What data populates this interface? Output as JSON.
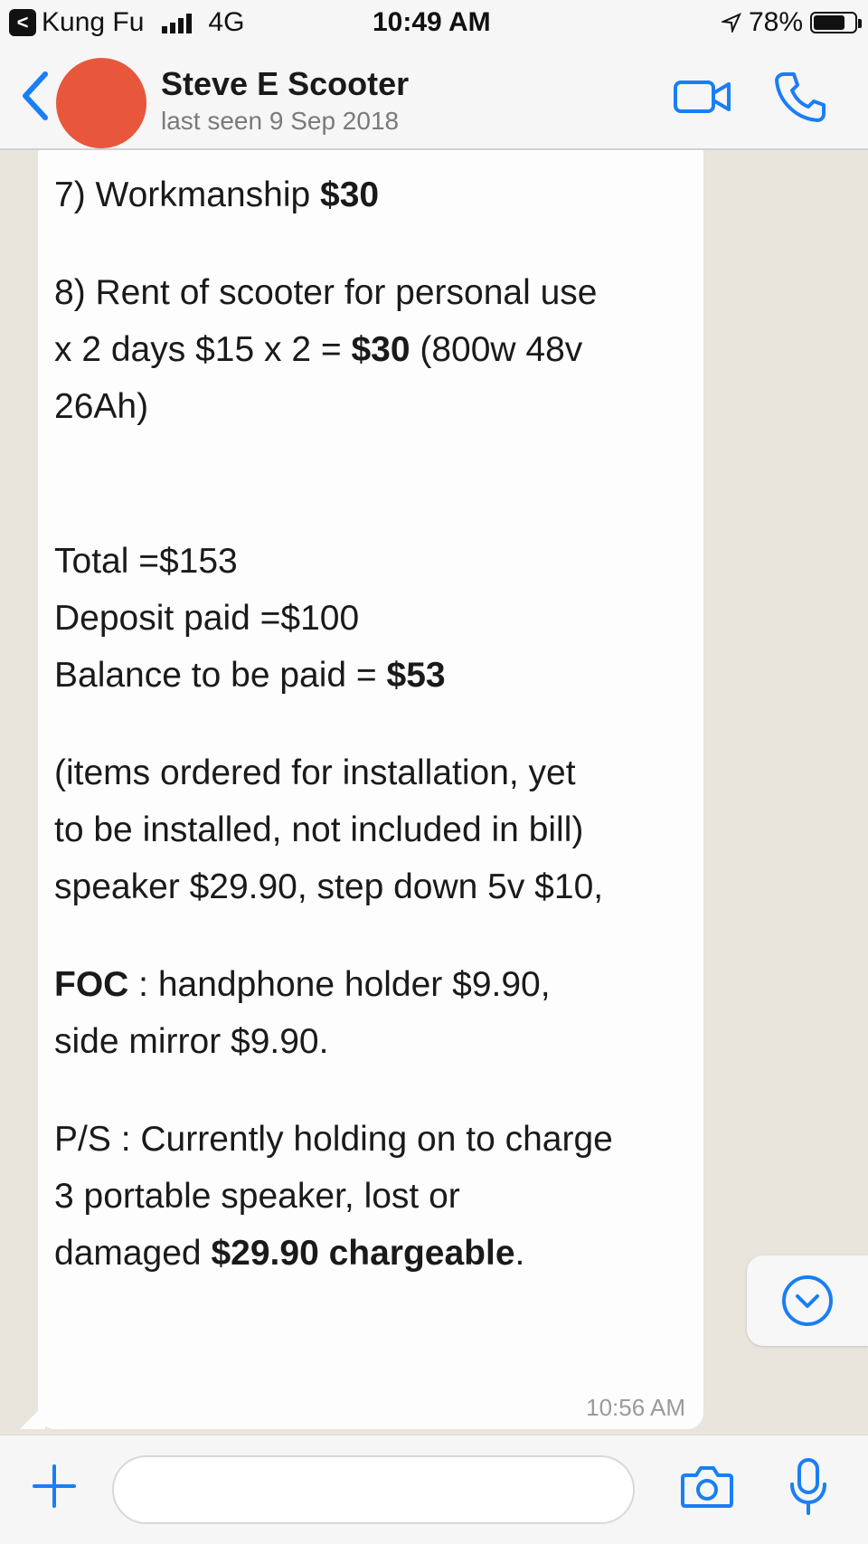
{
  "status_bar": {
    "back_app": "Kung Fu",
    "back_glyph": "<",
    "network": "4G",
    "time": "10:49 AM",
    "battery": "78%",
    "battery_level": 0.78
  },
  "header": {
    "contact_name": "Steve E Scooter",
    "last_seen": "last seen 9 Sep 2018"
  },
  "message": {
    "item7_prefix": "7) Workmanship ",
    "item7_amount": "$30",
    "item8_line1": "8)  Rent of scooter for personal use",
    "item8_line2_prefix": "x 2 days $15 x 2 = ",
    "item8_amount": "$30",
    "item8_line2_suffix": " (800w 48v",
    "item8_line3": "26Ah)",
    "total": "Total =$153",
    "deposit": "Deposit paid =$100",
    "balance_prefix": "Balance to be paid = ",
    "balance_amount": "$53",
    "items_line1": "(items ordered for installation, yet",
    "items_line2": "to be installed, not included in bill)",
    "items_line3": "speaker $29.90, step down 5v $10,",
    "foc_label": "FOC",
    "foc_line1_rest": " : handphone holder $9.90,",
    "foc_line2": "side mirror $9.90.",
    "ps_line1": "P/S : Currently holding on to charge",
    "ps_line2": "3 portable speaker, lost or",
    "ps_line3_prefix": "damaged ",
    "ps_line3_bold": "$29.90 chargeable",
    "ps_line3_end": ".",
    "timestamp": "10:56 AM"
  },
  "input": {
    "placeholder": ""
  },
  "colors": {
    "accent": "#1a7ef5",
    "chat_background": "#e9e4dc",
    "bubble": "#fdfdfd",
    "avatar": "#e8573c"
  },
  "icons": [
    "back-chevron-icon",
    "video-call-icon",
    "phone-call-icon",
    "scroll-down-icon",
    "plus-icon",
    "camera-icon",
    "microphone-icon"
  ]
}
